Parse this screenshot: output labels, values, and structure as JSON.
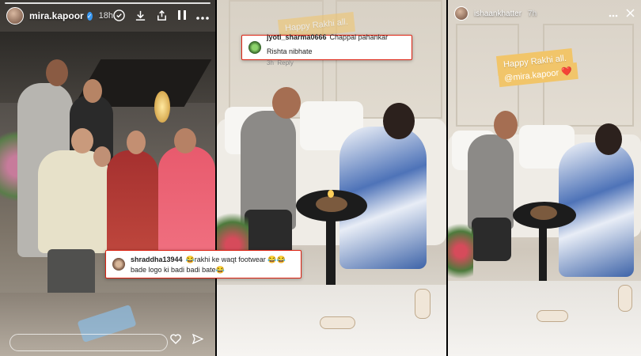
{
  "story1": {
    "username": "mira.kapoor",
    "time": "18h",
    "comment": {
      "username": "shraddha13944",
      "text": "😂rakhi ke waqt footwear 😂😂 bade logo ki badi badi bate😂"
    }
  },
  "story2": {
    "comment": {
      "username": "jyoti_sharma0666",
      "text": "Chappal pahankar Rishta nibhate",
      "age": "3h",
      "reply_label": "Reply"
    },
    "sticker_text": "Happy Rakhi all."
  },
  "story3": {
    "username": "ishaankhatter",
    "time": "7h",
    "sticker_text": "Happy Rakhi all.",
    "mention": "@mira.kapoor ❤️"
  },
  "colors": {
    "comment_border": "#dd1111",
    "sticker": "#f1c56a",
    "verified": "#3897f0"
  },
  "icons": [
    "mute-icon",
    "download-icon",
    "share-icon",
    "pause-icon",
    "more-icon",
    "close-icon",
    "heart-icon",
    "send-icon"
  ]
}
